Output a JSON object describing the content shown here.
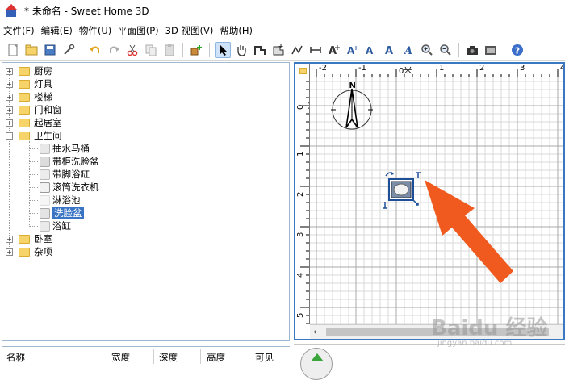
{
  "window": {
    "title": "* 未命名 - Sweet Home 3D"
  },
  "menu": [
    "文件(F)",
    "编辑(E)",
    "物件(U)",
    "平面图(P)",
    "3D 视图(V)",
    "帮助(H)"
  ],
  "toolbar": [
    {
      "icon": "new-icon"
    },
    {
      "icon": "open-icon"
    },
    {
      "icon": "save-icon"
    },
    {
      "icon": "preferences-icon"
    },
    {
      "sep": true
    },
    {
      "icon": "undo-icon"
    },
    {
      "icon": "redo-icon"
    },
    {
      "icon": "cut-icon"
    },
    {
      "icon": "copy-icon"
    },
    {
      "icon": "paste-icon"
    },
    {
      "sep": true
    },
    {
      "icon": "add-furniture-icon"
    },
    {
      "sep": true
    },
    {
      "icon": "select-icon",
      "selected": true
    },
    {
      "icon": "pan-icon"
    },
    {
      "icon": "create-walls-icon"
    },
    {
      "icon": "create-rooms-icon"
    },
    {
      "icon": "create-polylines-icon"
    },
    {
      "icon": "create-dimensions-icon"
    },
    {
      "icon": "create-labels-icon"
    },
    {
      "icon": "increase-text-icon"
    },
    {
      "icon": "decrease-text-icon"
    },
    {
      "icon": "bold-text-icon"
    },
    {
      "icon": "italic-text-icon"
    },
    {
      "icon": "zoom-in-icon"
    },
    {
      "icon": "zoom-out-icon"
    },
    {
      "sep": true
    },
    {
      "icon": "create-photo-icon"
    },
    {
      "icon": "create-video-icon"
    },
    {
      "sep": true
    },
    {
      "icon": "help-icon"
    }
  ],
  "tree": {
    "categories": [
      {
        "label": "厨房",
        "expanded": false
      },
      {
        "label": "灯具",
        "expanded": false
      },
      {
        "label": "楼梯",
        "expanded": false
      },
      {
        "label": "门和窗",
        "expanded": false
      },
      {
        "label": "起居室",
        "expanded": false
      },
      {
        "label": "卫生间",
        "expanded": true
      },
      {
        "label": "卧室",
        "expanded": false
      },
      {
        "label": "杂项",
        "expanded": false
      }
    ],
    "bathroom_items": [
      {
        "label": "抽水马桶",
        "icon": "toilet-icon",
        "selected": false
      },
      {
        "label": "带柜洗脸盆",
        "icon": "cabinet-sink-icon",
        "selected": false
      },
      {
        "label": "带脚浴缸",
        "icon": "clawfoot-tub-icon",
        "selected": false
      },
      {
        "label": "滚筒洗衣机",
        "icon": "washing-machine-icon",
        "selected": false
      },
      {
        "label": "淋浴池",
        "icon": "shower-icon",
        "selected": false
      },
      {
        "label": "洗脸盆",
        "icon": "sink-icon",
        "selected": true
      },
      {
        "label": "浴缸",
        "icon": "bathtub-icon",
        "selected": false
      }
    ]
  },
  "furniture_table": {
    "columns": [
      "名称",
      "宽度",
      "深度",
      "高度",
      "可见"
    ]
  },
  "plan": {
    "ruler_top": [
      "-2",
      "-1",
      "0米",
      "1",
      "2",
      "3",
      "4"
    ],
    "ruler_left": [
      "0米",
      "1",
      "2",
      "3",
      "4",
      "5"
    ],
    "compass_label": "N",
    "selected_object": "sink"
  },
  "watermark": {
    "brand": "Baidu 经验",
    "sub": "jingyan.baidu.com"
  },
  "colors": {
    "accent": "#3a78c2",
    "selection": "#3a74c4",
    "arrow": "#f05a1e",
    "grid_minor": "#d8d8d8",
    "grid_major": "#a8a8a8"
  }
}
